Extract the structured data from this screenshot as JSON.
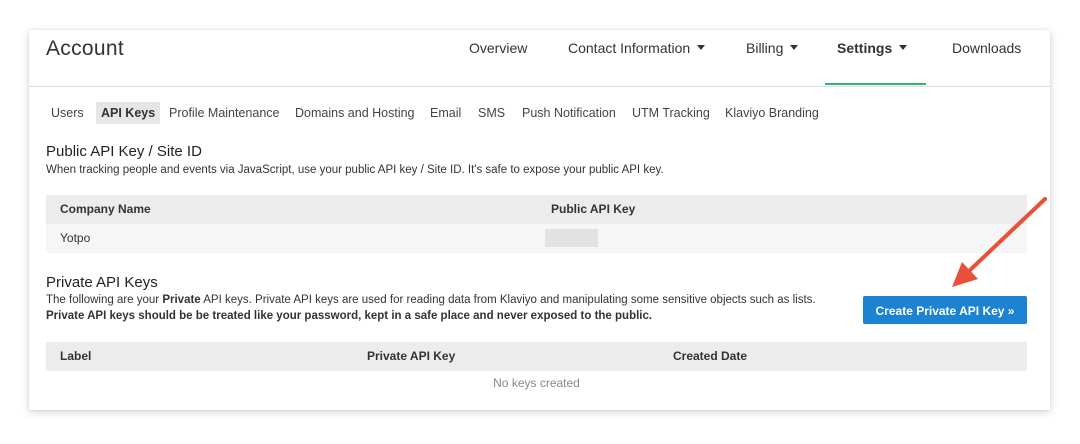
{
  "header": {
    "title": "Account"
  },
  "nav": [
    {
      "label": "Overview",
      "dropdown": false,
      "active": false
    },
    {
      "label": "Contact Information",
      "dropdown": true,
      "active": false
    },
    {
      "label": "Billing",
      "dropdown": true,
      "active": false
    },
    {
      "label": "Settings",
      "dropdown": true,
      "active": true
    },
    {
      "label": "Downloads",
      "dropdown": false,
      "active": false
    }
  ],
  "subnav": [
    {
      "label": "Users",
      "active": false
    },
    {
      "label": "API Keys",
      "active": true
    },
    {
      "label": "Profile Maintenance",
      "active": false
    },
    {
      "label": "Domains and Hosting",
      "active": false
    },
    {
      "label": "Email",
      "active": false
    },
    {
      "label": "SMS",
      "active": false
    },
    {
      "label": "Push Notification",
      "active": false
    },
    {
      "label": "UTM Tracking",
      "active": false
    },
    {
      "label": "Klaviyo Branding",
      "active": false
    }
  ],
  "public": {
    "title": "Public API Key / Site ID",
    "description": "When tracking people and events via JavaScript, use your public API key / Site ID. It's safe to expose your public API key.",
    "columns": [
      "Company Name",
      "Public API Key"
    ],
    "rows": [
      {
        "company": "Yotpo",
        "key_redacted": true
      }
    ]
  },
  "private": {
    "title": "Private API Keys",
    "desc_prefix": "The following are your ",
    "desc_bold": "Private",
    "desc_suffix": " API keys. Private API keys are used for reading data from Klaviyo and manipulating some sensitive objects such as lists.",
    "desc_warning": "Private API keys should be be treated like your password, kept in a safe place and never exposed to the public.",
    "create_button": "Create Private API Key »",
    "columns": [
      "Label",
      "Private API Key",
      "Created Date"
    ],
    "empty_text": "No keys created"
  },
  "colors": {
    "accent_underline": "#2bb673",
    "button": "#1c83d2",
    "annotation_arrow": "#e8503a"
  }
}
